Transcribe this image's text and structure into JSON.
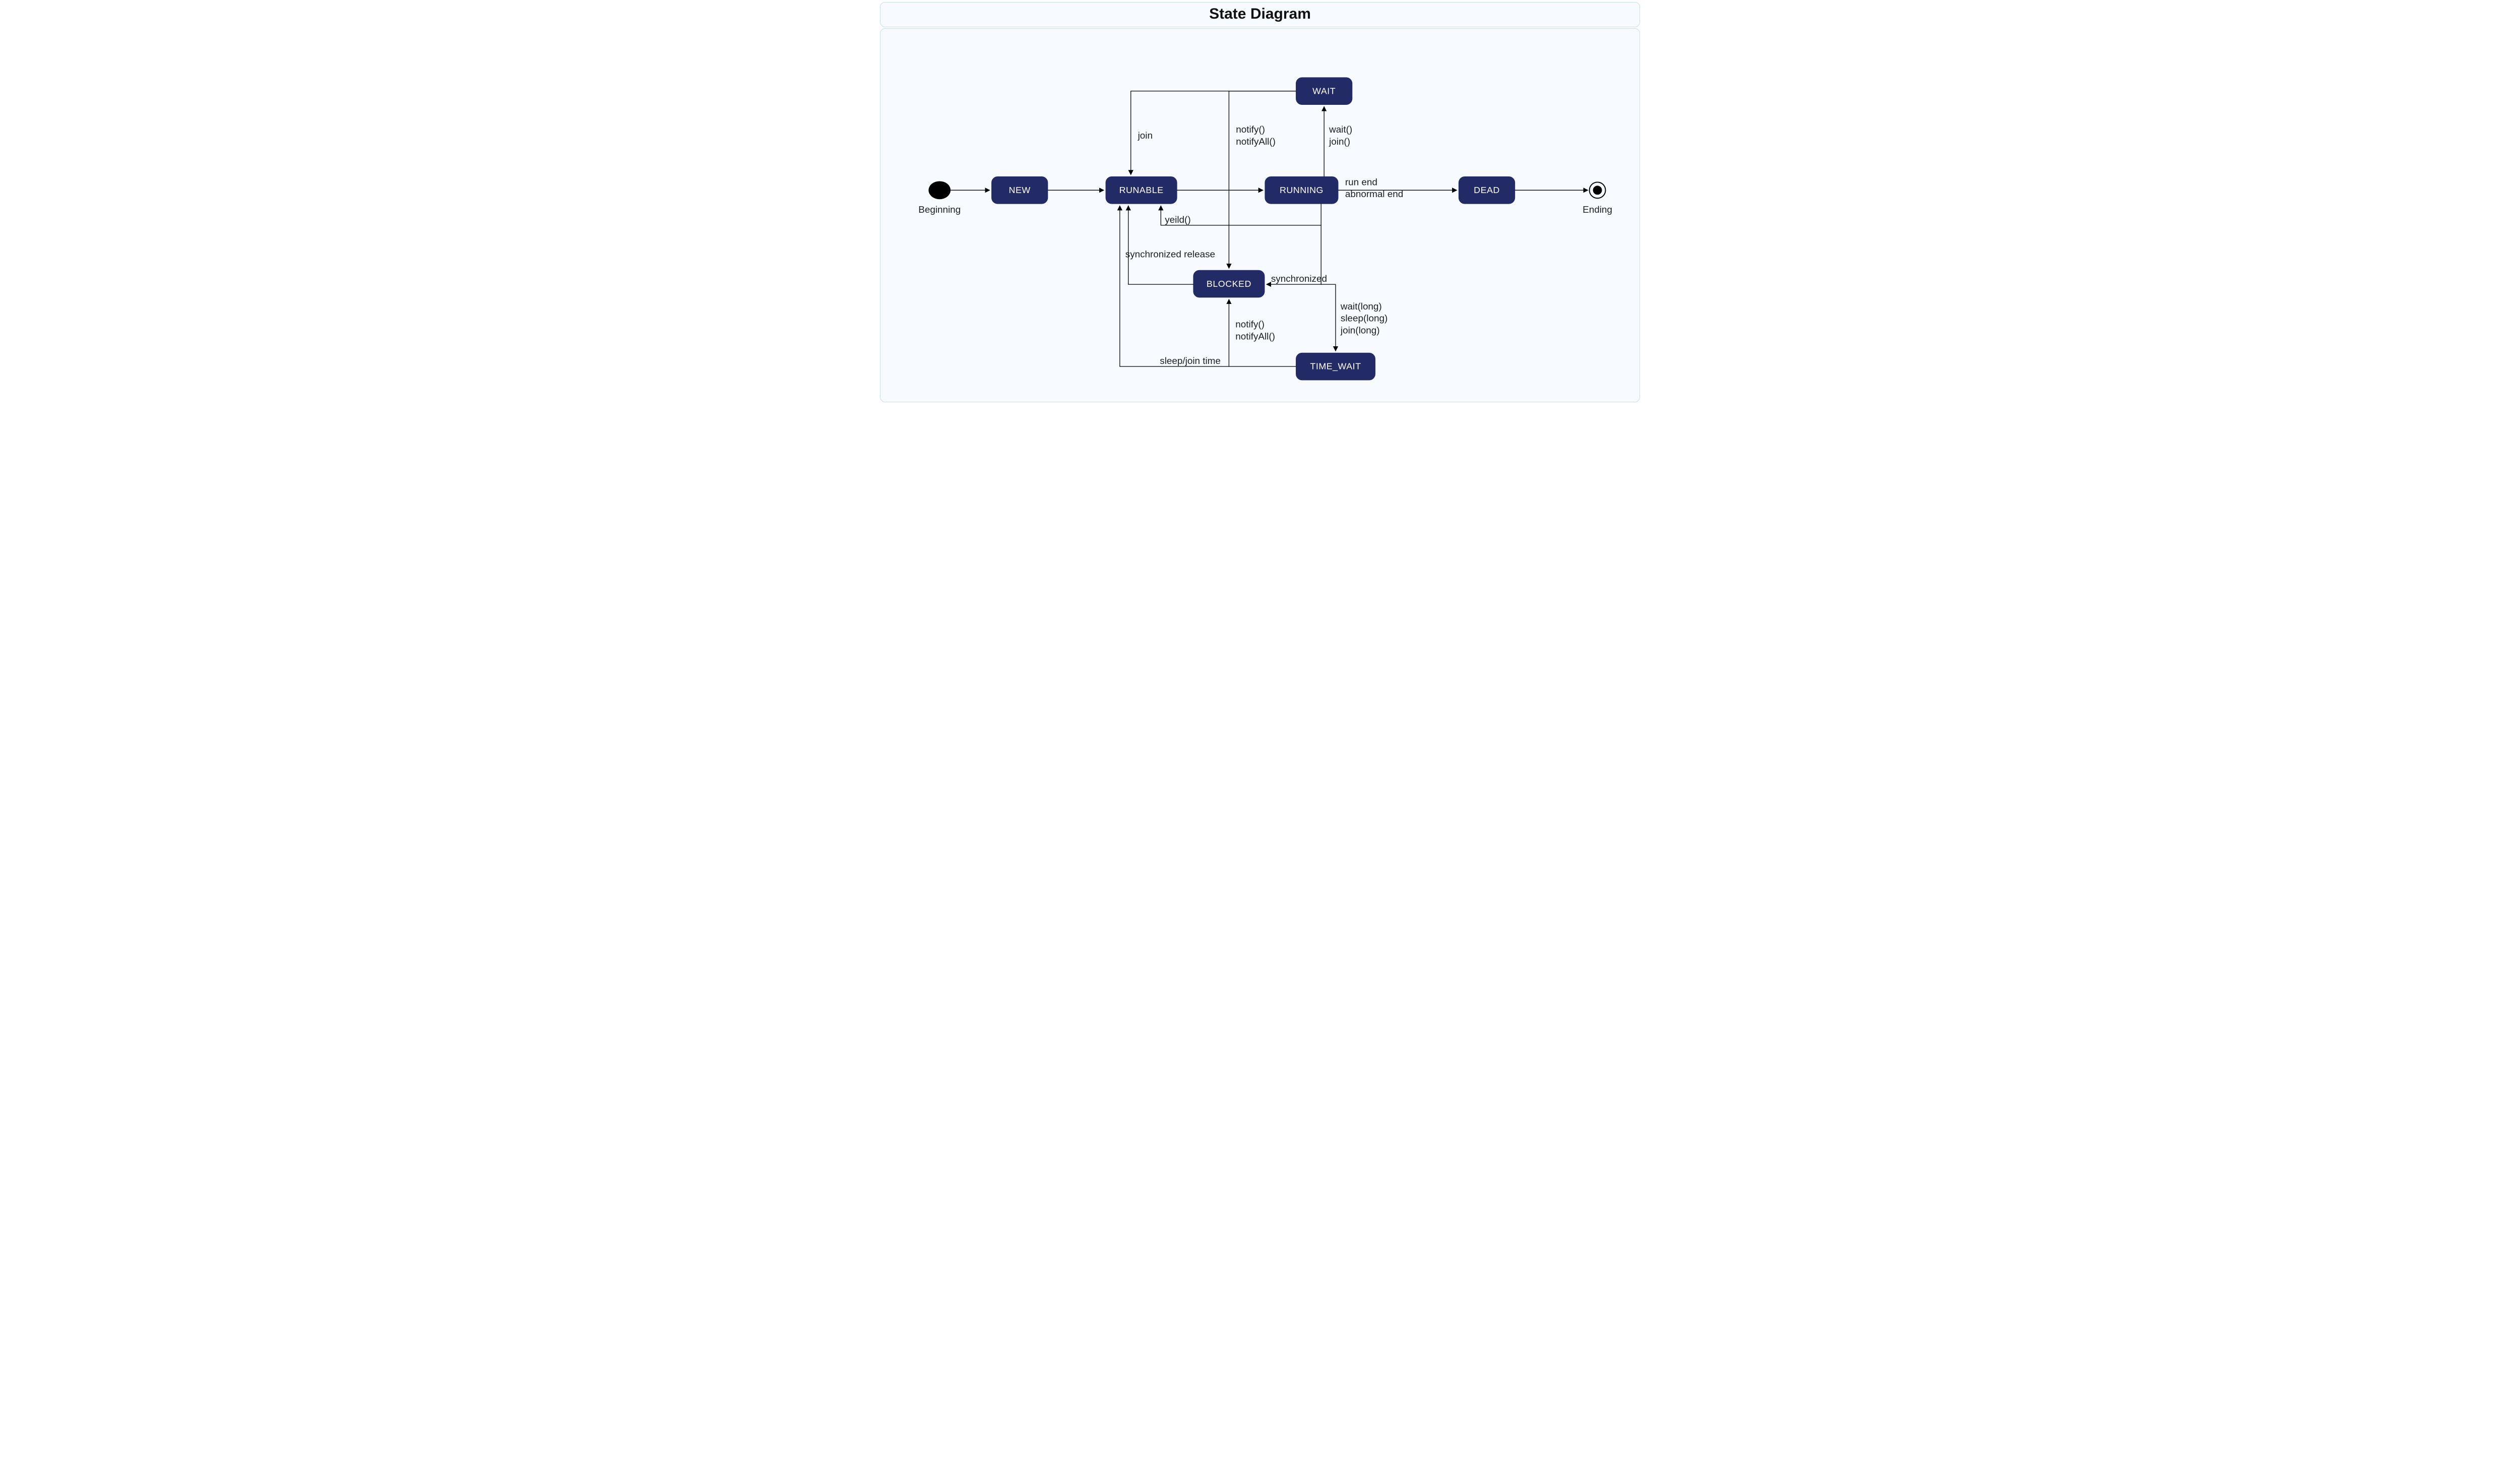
{
  "title": "State Diagram",
  "pseudoStates": {
    "initial": {
      "label": "Beginning"
    },
    "final": {
      "label": "Ending"
    }
  },
  "states": {
    "new": {
      "label": "NEW"
    },
    "runable": {
      "label": "RUNABLE"
    },
    "running": {
      "label": "RUNNING"
    },
    "dead": {
      "label": "DEAD"
    },
    "wait": {
      "label": "WAIT"
    },
    "blocked": {
      "label": "BLOCKED"
    },
    "timewait": {
      "label": "TIME_WAIT"
    }
  },
  "transitions": {
    "wait_to_runable": {
      "label": "join"
    },
    "wait_to_blocked": {
      "label": [
        "notify()",
        "notifyAll()"
      ]
    },
    "running_to_wait": {
      "label": [
        "wait()",
        "join()"
      ]
    },
    "running_to_dead": {
      "label": [
        "run end",
        "abnormal end"
      ]
    },
    "running_to_runable": {
      "label": "yeild()"
    },
    "blocked_to_runable": {
      "label": "synchronized release"
    },
    "running_to_blocked": {
      "label": "synchronized"
    },
    "running_to_timewait": {
      "label": [
        "wait(long)",
        "sleep(long)",
        "join(long)"
      ]
    },
    "timewait_to_blocked": {
      "label": [
        "notify()",
        "notifyAll()"
      ]
    },
    "timewait_to_runable": {
      "label": "sleep/join time"
    }
  }
}
